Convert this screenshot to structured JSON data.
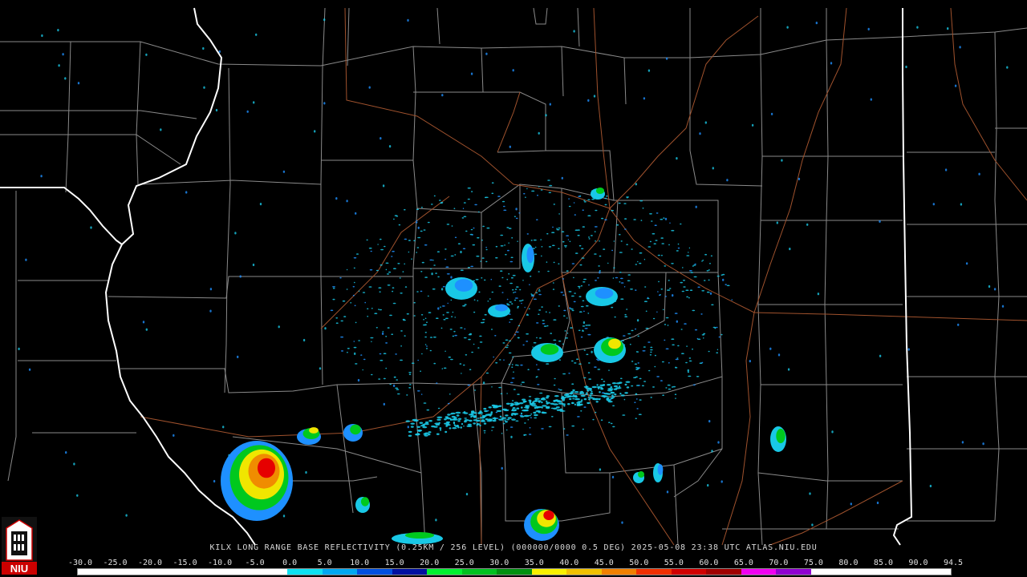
{
  "header": {
    "text": "KILX LONG RANGE BASE REFLECTIVITY (0.25KM / 256 LEVEL) (000000/0000 0.5 DEG) 2025-05-08 23:38 UTC  ATLAS.NIU.EDU"
  },
  "logo": {
    "text": "NIU",
    "colors": {
      "red": "#cc0000",
      "black": "#111111",
      "white": "#ffffff"
    }
  },
  "scale": {
    "labels": [
      "-30.0",
      "-25.0",
      "-20.0",
      "-15.0",
      "-10.0",
      "-5.0",
      "0.0",
      "5.0",
      "10.0",
      "15.0",
      "20.0",
      "25.0",
      "30.0",
      "35.0",
      "40.0",
      "45.0",
      "50.0",
      "55.0",
      "60.0",
      "65.0",
      "70.0",
      "75.0",
      "80.0",
      "85.0",
      "90.0",
      "94.5"
    ],
    "colors": [
      "#ffffff",
      "#ffffff",
      "#ffffff",
      "#ffffff",
      "#ffffff",
      "#ffffff",
      "#0fe0f0",
      "#00a8f0",
      "#0050e0",
      "#0010a0",
      "#00f030",
      "#00c020",
      "#009010",
      "#f8f000",
      "#f0c000",
      "#f08000",
      "#f03000",
      "#d00000",
      "#a00000",
      "#f000f0",
      "#9000d0",
      "#ffffff",
      "#ffffff",
      "#ffffff",
      "#ffffff"
    ]
  },
  "map": {
    "colors": {
      "background": "#000000",
      "county_line": "#8a8a8a",
      "state_line": "#ffffff",
      "highway": "#a0522d",
      "echo_light": "#19c8e6",
      "echo_mid": "#1e90ff",
      "echo_green": "#00c81e",
      "echo_yellow": "#f0e600",
      "echo_orange": "#f08c00",
      "echo_red": "#e60000"
    }
  }
}
